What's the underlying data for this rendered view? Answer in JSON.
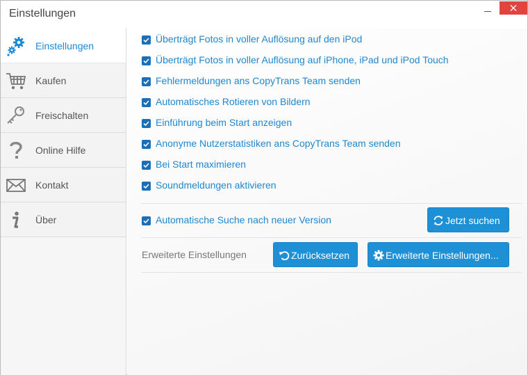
{
  "window": {
    "title": "Einstellungen"
  },
  "sidebar": {
    "items": [
      {
        "label": "Einstellungen",
        "icon": "gears-icon",
        "active": true
      },
      {
        "label": "Kaufen",
        "icon": "cart-icon",
        "active": false
      },
      {
        "label": "Freischalten",
        "icon": "key-icon",
        "active": false
      },
      {
        "label": "Online Hilfe",
        "icon": "question-icon",
        "active": false
      },
      {
        "label": "Kontakt",
        "icon": "envelope-icon",
        "active": false
      },
      {
        "label": "Über",
        "icon": "info-icon",
        "active": false
      }
    ]
  },
  "options": [
    {
      "label": "Überträgt Fotos in voller Auflösung auf den iPod",
      "checked": true
    },
    {
      "label": "Überträgt Fotos in voller Auflösung auf iPhone, iPad und iPod Touch",
      "checked": true
    },
    {
      "label": "Fehlermeldungen ans CopyTrans Team senden",
      "checked": true
    },
    {
      "label": "Automatisches Rotieren von Bildern",
      "checked": true
    },
    {
      "label": "Einführung beim Start anzeigen",
      "checked": true
    },
    {
      "label": "Anonyme Nutzerstatistiken ans CopyTrans Team senden",
      "checked": true
    },
    {
      "label": "Bei Start maximieren",
      "checked": true
    },
    {
      "label": "Soundmeldungen aktivieren",
      "checked": true
    }
  ],
  "update": {
    "label": "Automatische Suche nach neuer Version",
    "checked": true,
    "search_button": "Jetzt suchen"
  },
  "advanced": {
    "label": "Erweiterte Einstellungen",
    "reset_button": "Zurücksetzen",
    "advanced_button": "Erweiterte Einstellungen..."
  },
  "colors": {
    "accent": "#1e90d6",
    "link_text": "#1e87cf",
    "checkbox": "#1a6fb8",
    "close": "#e0443c"
  }
}
